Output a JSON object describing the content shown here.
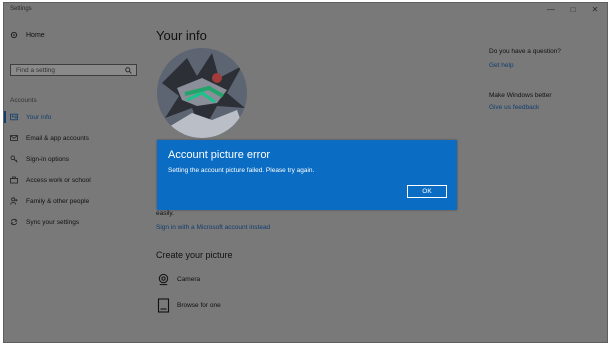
{
  "window": {
    "app_title": "Settings",
    "controls": {
      "minimize": "—",
      "maximize": "□",
      "close": "✕"
    }
  },
  "sidebar": {
    "home_label": "Home",
    "search_placeholder": "Find a setting",
    "section_label": "Accounts",
    "items": [
      {
        "label": "Your info",
        "icon": "person-card-icon",
        "active": true
      },
      {
        "label": "Email & app accounts",
        "icon": "mail-icon",
        "active": false
      },
      {
        "label": "Sign-in options",
        "icon": "key-icon",
        "active": false
      },
      {
        "label": "Access work or school",
        "icon": "briefcase-icon",
        "active": false
      },
      {
        "label": "Family & other people",
        "icon": "person-add-icon",
        "active": false
      },
      {
        "label": "Sync your settings",
        "icon": "sync-icon",
        "active": false
      }
    ]
  },
  "main": {
    "title": "Your info",
    "text_easily": "easily.",
    "link_microsoft_account": "Sign in with a Microsoft account instead",
    "create_heading": "Create your picture",
    "options": [
      {
        "label": "Camera",
        "icon": "camera-icon"
      },
      {
        "label": "Browse for one",
        "icon": "browse-file-icon"
      }
    ]
  },
  "right": {
    "question": "Do you have a question?",
    "get_help": "Get help",
    "make_better": "Make Windows better",
    "feedback": "Give us feedback"
  },
  "dialog": {
    "title": "Account picture error",
    "message": "Setting the account picture failed. Please try again.",
    "ok_label": "OK"
  },
  "colors": {
    "overlay_gray": "#797979",
    "dialog_blue": "#0a6cc2",
    "link_blue": "#123e6e"
  }
}
